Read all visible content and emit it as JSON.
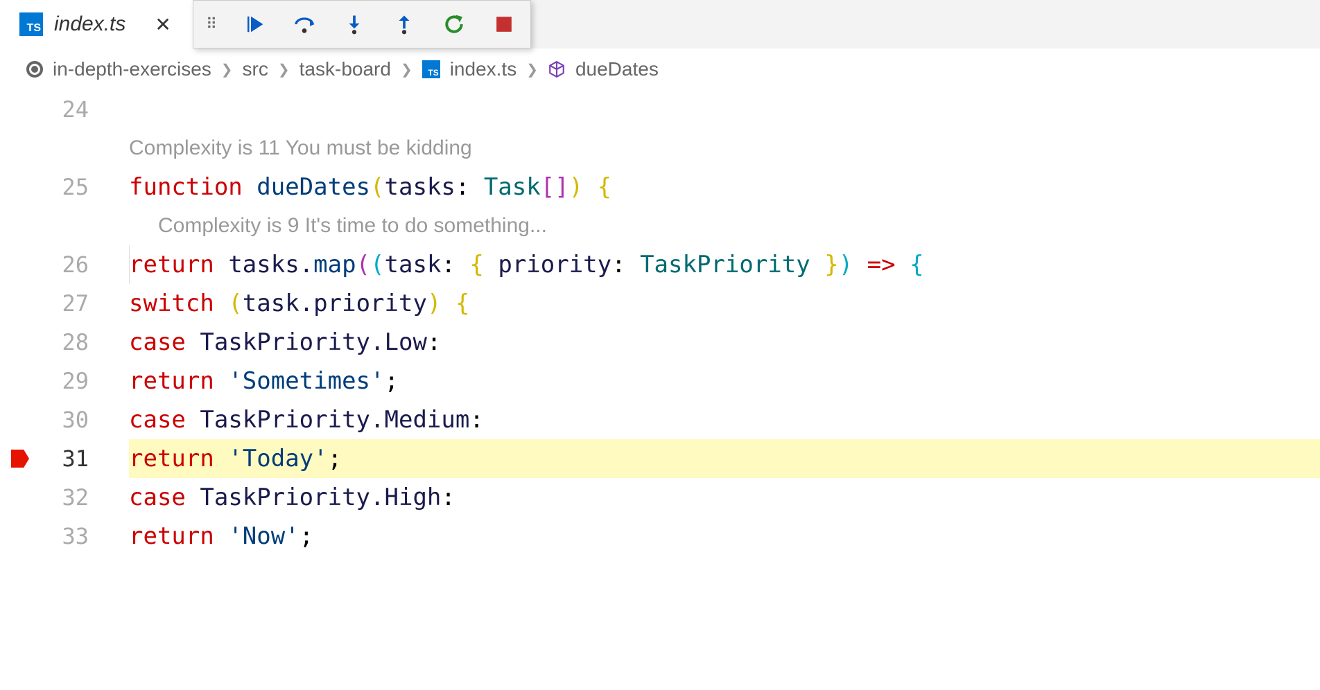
{
  "tab": {
    "title": "index.ts",
    "icon": "TS"
  },
  "debug": {
    "continue": "Continue",
    "step_over": "Step Over",
    "step_into": "Step Into",
    "step_out": "Step Out",
    "restart": "Restart",
    "stop": "Stop"
  },
  "breadcrumb": {
    "items": [
      "in-depth-exercises",
      "src",
      "task-board",
      "index.ts",
      "dueDates"
    ],
    "file_icon": "TS"
  },
  "hints": {
    "h1": "Complexity is 11 You must be kidding",
    "h2": "Complexity is 9 It's time to do something..."
  },
  "lines": {
    "l24": "24",
    "l25": "25",
    "l26": "26",
    "l27": "27",
    "l28": "28",
    "l29": "29",
    "l30": "30",
    "l31": "31",
    "l32": "32",
    "l33": "33"
  },
  "code": {
    "l25": {
      "kw": "function",
      "sp1": " ",
      "fn": "dueDates",
      "p1": "(",
      "arg": "tasks",
      "colon": ": ",
      "type": "Task",
      "br": "[]",
      "p2": ")",
      "sp2": " ",
      "brace": "{"
    },
    "l26": {
      "kw": "return",
      "sp1": " ",
      "obj": "tasks",
      "dot": ".",
      "method": "map",
      "p1": "(",
      "p2": "(",
      "arg": "task",
      "colon": ": ",
      "b1": "{",
      "sp2": " ",
      "prop": "priority",
      "colon2": ": ",
      "type": "TaskPriority",
      "sp3": " ",
      "b2": "}",
      "p3": ")",
      "sp4": " ",
      "arrow": "=>",
      "sp5": " ",
      "brace": "{"
    },
    "l27": {
      "kw": "switch",
      "sp1": " ",
      "p1": "(",
      "obj": "task",
      "dot": ".",
      "prop": "priority",
      "p2": ")",
      "sp2": " ",
      "brace": "{"
    },
    "l28": {
      "kw": "case",
      "sp1": " ",
      "type": "TaskPriority",
      "dot": ".",
      "val": "Low",
      "colon": ":"
    },
    "l29": {
      "kw": "return",
      "sp1": " ",
      "str": "'Sometimes'",
      "semi": ";"
    },
    "l30": {
      "kw": "case",
      "sp1": " ",
      "type": "TaskPriority",
      "dot": ".",
      "val": "Medium",
      "colon": ":"
    },
    "l31": {
      "kw": "return",
      "sp1": " ",
      "str": "'Today'",
      "semi": ";"
    },
    "l32": {
      "kw": "case",
      "sp1": " ",
      "type": "TaskPriority",
      "dot": ".",
      "val": "High",
      "colon": ":"
    },
    "l33": {
      "kw": "return",
      "sp1": " ",
      "str": "'Now'",
      "semi": ";"
    }
  },
  "current_line": 31
}
